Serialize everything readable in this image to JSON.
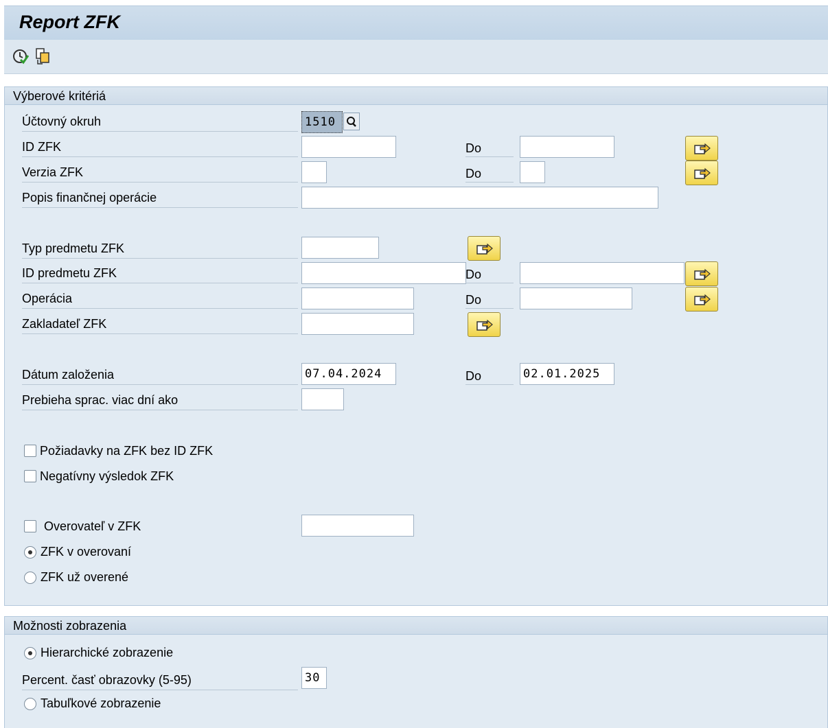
{
  "window": {
    "title": "Report ZFK"
  },
  "toolbar": {
    "execute_icon": "execute-icon",
    "variant_icon": "get-variant-icon"
  },
  "selection_group": {
    "title": "Výberové kritériá",
    "company_code": {
      "label": "Účtovný okruh",
      "value": "1510"
    },
    "zfk_id": {
      "label": "ID ZFK",
      "from": "",
      "to_label": "Do",
      "to": ""
    },
    "zfk_version": {
      "label": "Verzia ZFK",
      "from": "",
      "to_label": "Do",
      "to": ""
    },
    "fin_op_desc": {
      "label": "Popis finančnej operácie",
      "value": ""
    },
    "subject_type": {
      "label": "Typ predmetu ZFK",
      "value": ""
    },
    "subject_id": {
      "label": "ID predmetu ZFK",
      "from": "",
      "to_label": "Do",
      "to": ""
    },
    "operation": {
      "label": "Operácia",
      "from": "",
      "to_label": "Do",
      "to": ""
    },
    "founder": {
      "label": "Zakladateľ ZFK",
      "value": ""
    },
    "created_date": {
      "label": "Dátum založenia",
      "from": "07.04.2024",
      "to_label": "Do",
      "to": "02.01.2025"
    },
    "processing_days": {
      "label": "Prebieha sprac. viac dní ako",
      "value": ""
    },
    "req_without_id": {
      "label": "Požiadavky na ZFK bez ID ZFK",
      "checked": false
    },
    "negative_result": {
      "label": "Negatívny výsledok ZFK",
      "checked": false
    },
    "verifier": {
      "label": "Overovateľ v ZFK",
      "checked": false,
      "value": ""
    },
    "in_verification": {
      "label": "ZFK v overovaní",
      "selected": true
    },
    "already_verified": {
      "label": "ZFK už overené",
      "selected": false
    }
  },
  "display_group": {
    "title": "Možnosti zobrazenia",
    "hierarchical": {
      "label": "Hierarchické zobrazenie",
      "selected": true
    },
    "screen_percent": {
      "label": "Percent. časť obrazovky (5-95)",
      "value": "30"
    },
    "tabular": {
      "label": "Tabuľkové zobrazenie",
      "selected": false
    }
  }
}
